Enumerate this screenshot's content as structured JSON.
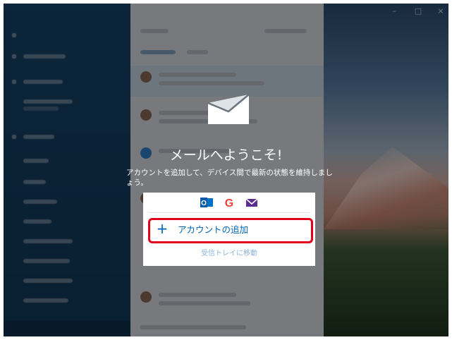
{
  "welcome": {
    "title": "メールへようこそ!",
    "subtitle": "アカウントを追加して、デバイス間で最新の状態を維持しましょう。"
  },
  "providers": [
    {
      "icon": "outlook-icon",
      "color": "#0072c6"
    },
    {
      "icon": "google-icon",
      "color": "#4285f4"
    },
    {
      "icon": "yahoo-mail-icon",
      "color": "#5c2d91"
    }
  ],
  "actions": {
    "add_account": "アカウントの追加",
    "go_to_inbox": "受信トレイに移動"
  },
  "colors": {
    "accent": "#0063b1",
    "highlight": "#e2001a",
    "sidebar": "#16446a"
  }
}
